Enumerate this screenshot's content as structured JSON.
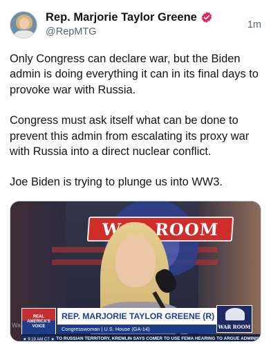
{
  "author": {
    "name": "Rep. Marjorie Taylor Greene",
    "handle": "@RepMTG",
    "verified_icon": "verified-badge-icon",
    "verified_color": "#e0245e"
  },
  "timestamp": "1m",
  "tweet": {
    "paragraphs": [
      "Only Congress can declare war, but the Biden admin is doing everything it can in its final days to provoke war with Russia.",
      "Congress must ask itself what can be done to prevent this admin from escalating its proxy war with Russia into a direct nuclear conflict.",
      "Joe Biden is trying to plunge us into WW3."
    ]
  },
  "media": {
    "banner_text": "WAR ROOM",
    "lower_third": {
      "network_logo": [
        "REAL",
        "AMERICA'S",
        "VOICE"
      ],
      "name": "REP. MARJORIE TAYLOR GREENE (R)",
      "subtitle": "Congresswoman | U.S. House (GA-14)",
      "time": "★ 9:19 AM CT ★",
      "ticker": "SE MISSILES INTO RUSSIAN TERRITORY, KREMLIN SAYS      COMER TO USE FEMA HEARING TO ARGUE ADMINIS",
      "show_logo": "WAR ROOM",
      "watermark": "Wa"
    }
  }
}
